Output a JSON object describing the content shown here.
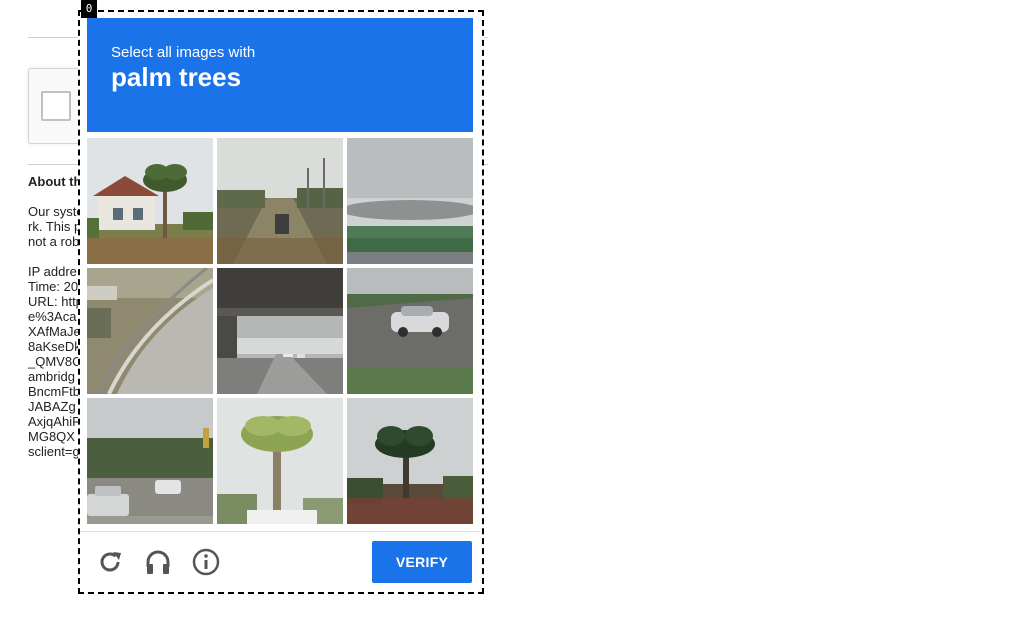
{
  "focus_index": "0",
  "background_page": {
    "about_title": "About th",
    "about_lines": [
      "Our syste",
      "rk. This p",
      "not a rob"
    ],
    "tech_lines": [
      "IP addre",
      "Time: 20",
      "URL: http",
      "e%3Aca",
      "XAfMaJe",
      "8aKseDk",
      "_QMV8C",
      "ambridg",
      "BncmFtb",
      "JABAZg",
      "AxjqAhiF",
      "MG8QX",
      "sclient=g"
    ]
  },
  "challenge": {
    "instruction": "Select all images with",
    "keyword": "palm trees",
    "tiles": [
      {
        "description": "house with palm tree"
      },
      {
        "description": "road with trees"
      },
      {
        "description": "sky and tree line"
      },
      {
        "description": "curved road with guardrail"
      },
      {
        "description": "overpass highway"
      },
      {
        "description": "white car on road"
      },
      {
        "description": "cars on street"
      },
      {
        "description": "tall palm tree"
      },
      {
        "description": "dark palm tree"
      }
    ],
    "verify_label": "VERIFY"
  },
  "colors": {
    "accent": "#1a73e8"
  }
}
